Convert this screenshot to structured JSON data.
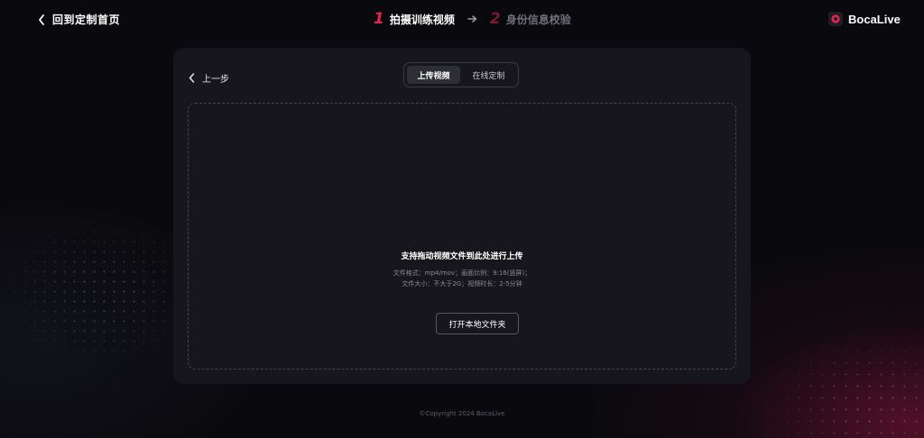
{
  "header": {
    "back_home_label": "回到定制首页",
    "steps": [
      {
        "number": "1",
        "label": "拍摄训练视频",
        "state": "active"
      },
      {
        "number": "2",
        "label": "身份信息校验",
        "state": "inactive"
      }
    ],
    "brand_name": "BocaLive",
    "accent_color": "#e6264f"
  },
  "card": {
    "back_label": "上一步",
    "tabs": [
      {
        "label": "上传视频",
        "active": true
      },
      {
        "label": "在线定制",
        "active": false
      }
    ],
    "dropzone": {
      "title": "支持拖动视频文件到此处进行上传",
      "hint_line1": "文件格式：mp4/mov；画面比例：9:16(竖屏)；",
      "hint_line2": "文件大小：不大于2G；视频时长：2-5分钟",
      "button_label": "打开本地文件夹"
    }
  },
  "footer": {
    "copyright": "©Copyright 2024 BocaLive"
  },
  "icons": {
    "back_home": "chevron-left-icon",
    "back_step": "chevron-left-icon",
    "step_arrow": "arrow-right-icon",
    "brand": "bocalive-logo-icon"
  }
}
